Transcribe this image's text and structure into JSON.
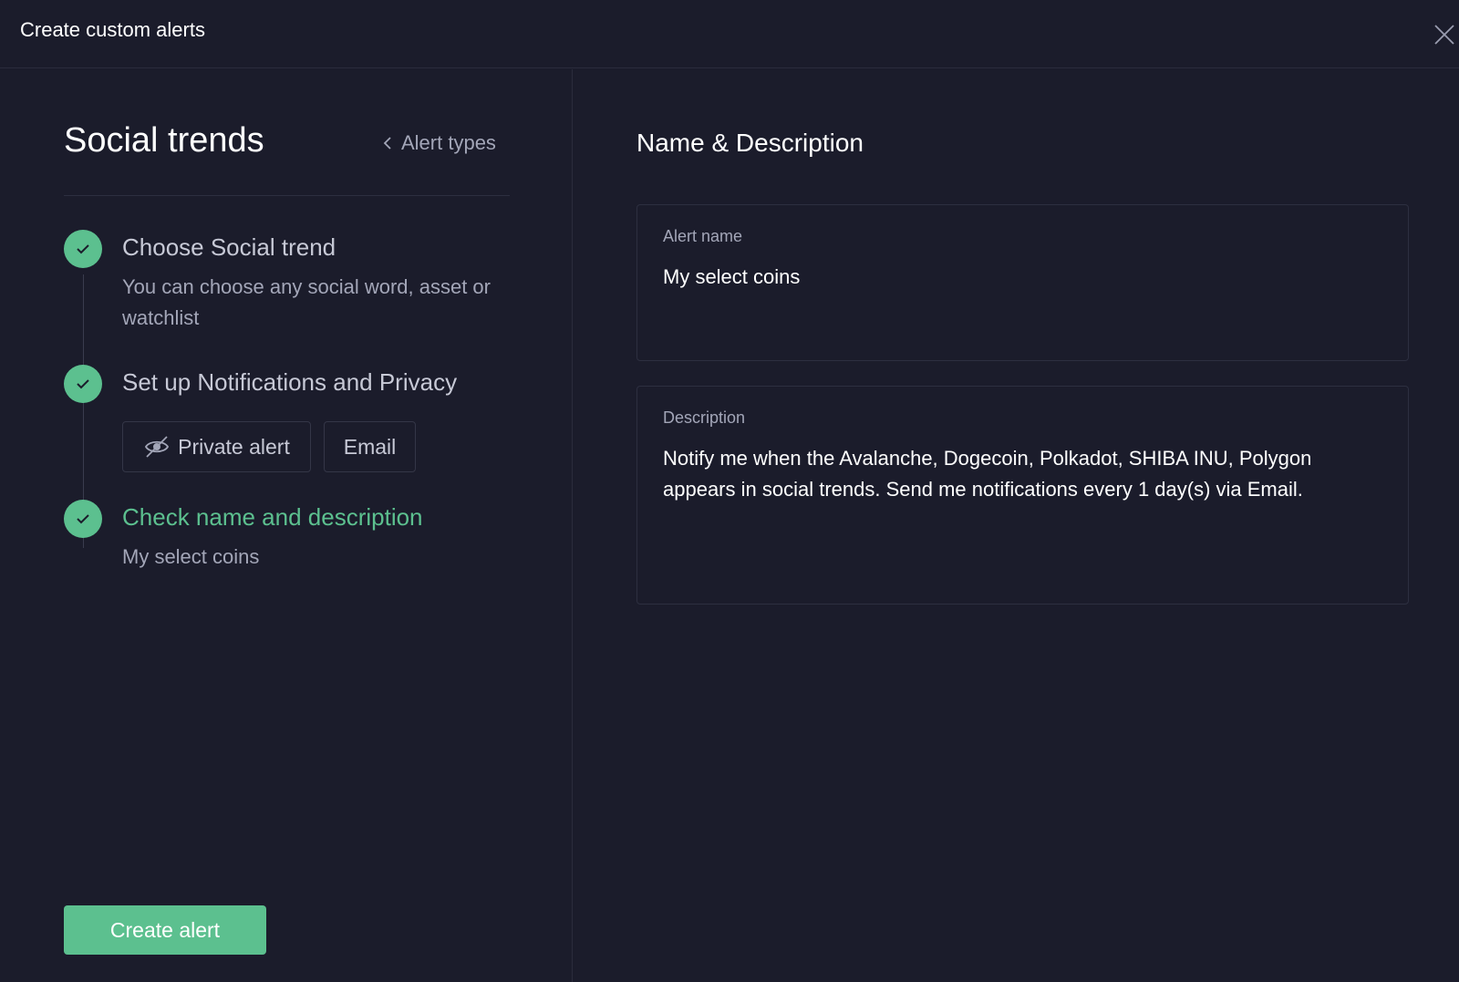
{
  "header": {
    "title": "Create custom alerts"
  },
  "left": {
    "title": "Social trends",
    "back_label": "Alert types",
    "steps": [
      {
        "title": "Choose Social trend",
        "description": "You can choose any social word, asset or watchlist"
      },
      {
        "title": "Set up Notifications and Privacy",
        "chips": [
          "Private alert",
          "Email"
        ]
      },
      {
        "title": "Check name and description",
        "description": "My select coins"
      }
    ],
    "create_label": "Create alert"
  },
  "right": {
    "title": "Name & Description",
    "name_field": {
      "label": "Alert name",
      "value": "My select coins"
    },
    "description_field": {
      "label": "Description",
      "value": "Notify me when the Avalanche, Dogecoin, Polkadot, SHIBA INU, Polygon appears in social trends. Send me notifications every 1 day(s) via Email."
    }
  },
  "colors": {
    "background": "#1b1c2b",
    "accent": "#5cc08f",
    "muted_text": "#a3a6b8",
    "border": "#2d2f40"
  },
  "icons": [
    "close-icon",
    "chevron-left-icon",
    "check-icon",
    "eye-off-icon"
  ]
}
